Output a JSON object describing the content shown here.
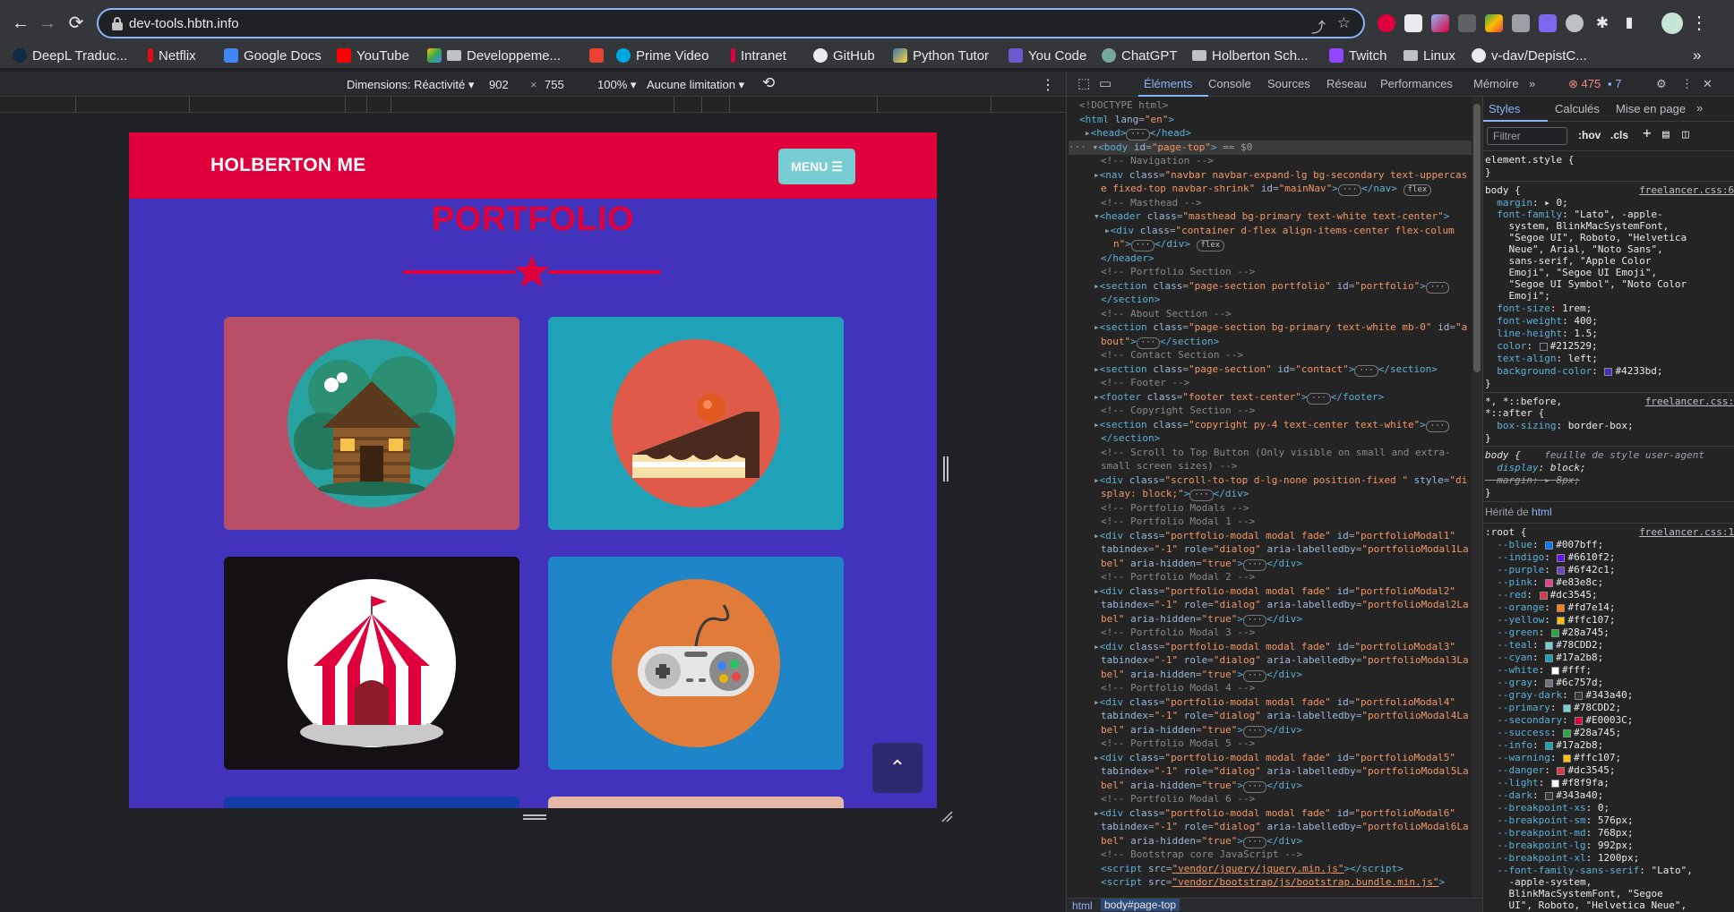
{
  "browser": {
    "url": "dev-tools.hbtn.info",
    "bookmarks": [
      "DeepL Traduc...",
      "Netflix",
      "Google Docs",
      "YouTube",
      "Developpeme...",
      "Prime Video",
      "Intranet",
      "GitHub",
      "Python Tutor",
      "You Code",
      "ChatGPT",
      "Holberton Sch...",
      "Twitch",
      "Linux",
      "v-dav/DepistC..."
    ],
    "more_bookmarks": "»"
  },
  "device_toolbar": {
    "dimensions_label": "Dimensions: Réactivité",
    "width": "902",
    "times": "×",
    "height": "755",
    "zoom": "100%",
    "throttling": "Aucune limitation"
  },
  "site": {
    "brand": "HOLBERTON ME",
    "menu_label": "MENU",
    "section_title": "PORTFOLIO",
    "cards": [
      {
        "name": "cabin",
        "bg": "#b84e68"
      },
      {
        "name": "cake",
        "bg": "#1fa2b8"
      },
      {
        "name": "circus",
        "bg": "#141014"
      },
      {
        "name": "game-controller",
        "bg": "#1e85c8"
      }
    ],
    "colors": {
      "primary": "#4233bd",
      "secondary": "#e0003c",
      "teal": "#78cdd2"
    }
  },
  "devtools": {
    "tabs": [
      "Éléments",
      "Console",
      "Sources",
      "Réseau",
      "Performances",
      "Mémoire"
    ],
    "error_count": "475",
    "message_count": "7",
    "breadcrumbs": [
      "html",
      "body#page-top"
    ],
    "styles_tabs": [
      "Styles",
      "Calculés",
      "Mise en page"
    ],
    "filter_placeholder": "Filtrer",
    "hov_label": ":hov",
    "cls_label": ".cls"
  }
}
